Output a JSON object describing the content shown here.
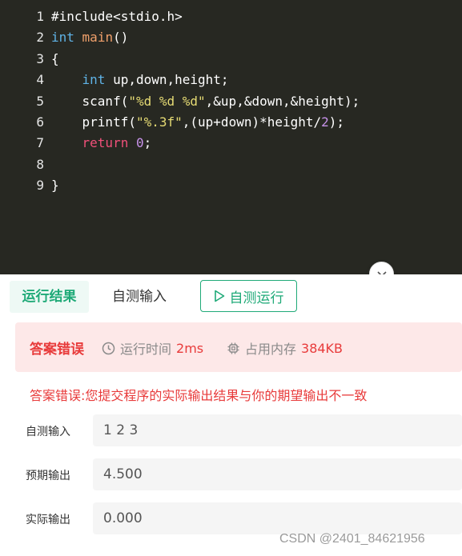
{
  "editor": {
    "lines": [
      {
        "no": "1",
        "tokens": [
          {
            "t": "#include<stdio.h>",
            "c": "code"
          }
        ]
      },
      {
        "no": "2",
        "tokens": [
          {
            "t": "int",
            "c": "kw"
          },
          {
            "t": " ",
            "c": "code"
          },
          {
            "t": "main",
            "c": "fn"
          },
          {
            "t": "()",
            "c": "code"
          }
        ]
      },
      {
        "no": "3",
        "tokens": [
          {
            "t": "{",
            "c": "code"
          }
        ]
      },
      {
        "no": "4",
        "tokens": [
          {
            "t": "    ",
            "c": "code"
          },
          {
            "t": "int",
            "c": "kw"
          },
          {
            "t": " up,down,height;",
            "c": "code"
          }
        ]
      },
      {
        "no": "5",
        "tokens": [
          {
            "t": "    scanf(",
            "c": "code"
          },
          {
            "t": "\"%d %d %d\"",
            "c": "str"
          },
          {
            "t": ",&up,&down,&height);",
            "c": "code"
          }
        ]
      },
      {
        "no": "6",
        "tokens": [
          {
            "t": "    printf(",
            "c": "code"
          },
          {
            "t": "\"%.3f\"",
            "c": "str"
          },
          {
            "t": ",(up+down)*height/",
            "c": "code"
          },
          {
            "t": "2",
            "c": "num"
          },
          {
            "t": ");",
            "c": "code"
          }
        ]
      },
      {
        "no": "7",
        "tokens": [
          {
            "t": "    ",
            "c": "code"
          },
          {
            "t": "return",
            "c": "ret"
          },
          {
            "t": " ",
            "c": "code"
          },
          {
            "t": "0",
            "c": "num"
          },
          {
            "t": ";",
            "c": "code"
          }
        ]
      },
      {
        "no": "8",
        "tokens": [
          {
            "t": "",
            "c": "code"
          }
        ]
      },
      {
        "no": "9",
        "tokens": [
          {
            "t": "}",
            "c": "code"
          }
        ]
      }
    ]
  },
  "collapse_icon": "chevron-down-icon",
  "tabs": {
    "result_label": "运行结果",
    "input_label": "自测输入",
    "run_label": "自测运行",
    "run_icon": "play-icon"
  },
  "status": {
    "title": "答案错误",
    "time_label": "运行时间",
    "time_value": "2ms",
    "memory_label": "占用内存",
    "memory_value": "384KB"
  },
  "error_message": "答案错误:您提交程序的实际输出结果与你的期望输出不一致",
  "rows": {
    "input": {
      "label": "自测输入",
      "value": "1 2 3"
    },
    "expected": {
      "label": "预期输出",
      "value": "4.500"
    },
    "actual": {
      "label": "实际输出",
      "value": "0.000"
    }
  },
  "watermark": "CSDN @2401_84621956",
  "colors": {
    "editor_bg": "#272822",
    "accent_green": "#1faa78",
    "error_red": "#e83b3b",
    "error_bg": "#fde8e8"
  }
}
